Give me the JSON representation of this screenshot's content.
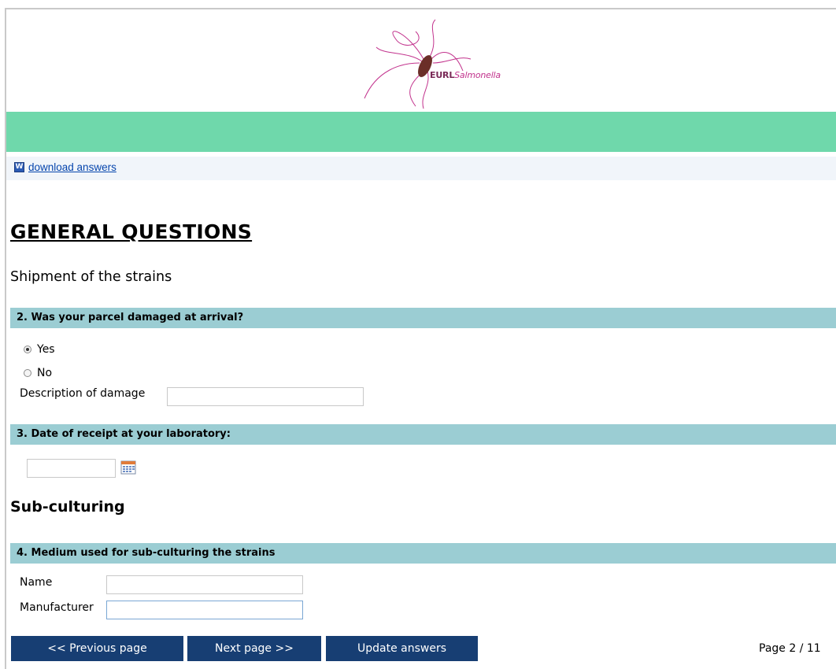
{
  "header": {
    "logo_text_bold": "EURL",
    "logo_text_italic": "Salmonella"
  },
  "download": {
    "label": "download answers"
  },
  "page": {
    "title": "GENERAL QUESTIONS",
    "section": "Shipment of the strains"
  },
  "q2": {
    "title": "2.  Was your parcel damaged at arrival?",
    "options": [
      {
        "label": "Yes",
        "selected": true
      },
      {
        "label": "No",
        "selected": false
      }
    ],
    "description_label": "Description of damage",
    "description_value": ""
  },
  "q3": {
    "title": "3. Date of receipt at your laboratory:",
    "date_value": ""
  },
  "subsection": "Sub-culturing",
  "q4": {
    "title": "4. Medium used for sub-culturing the strains",
    "name_label": "Name",
    "name_value": "",
    "manufacturer_label": "Manufacturer",
    "manufacturer_value": ""
  },
  "nav": {
    "prev": "<< Previous page",
    "next": "Next page >>",
    "update": "Update answers",
    "page_indicator": "Page 2 / 11"
  },
  "colors": {
    "green_band": "#6fd8ab",
    "question_bar": "#9bcdd3",
    "button": "#173e73",
    "link": "#0645ad"
  }
}
